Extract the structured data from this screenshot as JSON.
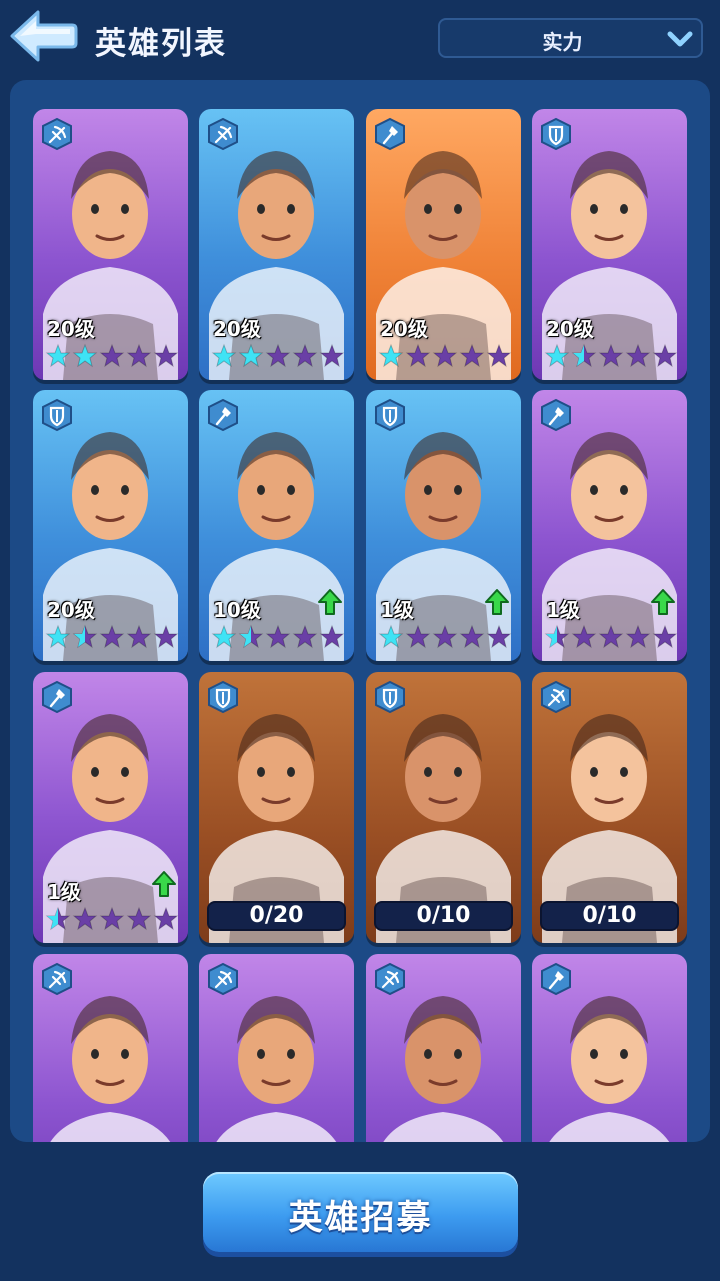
{
  "header": {
    "title": "英雄列表",
    "back_icon": "back-arrow-icon",
    "sort": {
      "selected": "实力",
      "icon": "chevron-down-icon"
    }
  },
  "heroes": [
    {
      "class": "crossbow",
      "bg": "purple",
      "level": "20级",
      "stars_full": 2,
      "stars_half": 0,
      "upgrade": false
    },
    {
      "class": "crossbow",
      "bg": "blue",
      "level": "20级",
      "stars_full": 2,
      "stars_half": 0,
      "upgrade": false
    },
    {
      "class": "staff",
      "bg": "orange",
      "level": "20级",
      "stars_full": 1,
      "stars_half": 0,
      "upgrade": false
    },
    {
      "class": "shield",
      "bg": "purple",
      "level": "20级",
      "stars_full": 1,
      "stars_half": 1,
      "upgrade": false
    },
    {
      "class": "shield",
      "bg": "blue",
      "level": "20级",
      "stars_full": 1,
      "stars_half": 1,
      "upgrade": false
    },
    {
      "class": "staff",
      "bg": "blue",
      "level": "10级",
      "stars_full": 1,
      "stars_half": 1,
      "upgrade": true
    },
    {
      "class": "shield",
      "bg": "blue",
      "level": "1级",
      "stars_full": 1,
      "stars_half": 0,
      "upgrade": true
    },
    {
      "class": "staff",
      "bg": "purple",
      "level": "1级",
      "stars_full": 0,
      "stars_half": 1,
      "upgrade": true
    },
    {
      "class": "staff",
      "bg": "purple",
      "level": "1级",
      "stars_full": 0,
      "stars_half": 1,
      "upgrade": true
    },
    {
      "class": "shield",
      "bg": "locked",
      "progress": "0/20"
    },
    {
      "class": "shield",
      "bg": "locked",
      "progress": "0/10"
    },
    {
      "class": "crossbow",
      "bg": "locked",
      "progress": "0/10"
    },
    {
      "class": "crossbow",
      "bg": "purple"
    },
    {
      "class": "crossbow",
      "bg": "purple"
    },
    {
      "class": "crossbow",
      "bg": "purple"
    },
    {
      "class": "staff",
      "bg": "purple"
    }
  ],
  "recruit_button": "英雄招募",
  "colors": {
    "star_active": "#3fe3f5",
    "star_inactive": "#6a3fa6",
    "upgrade": "#39d84a"
  }
}
